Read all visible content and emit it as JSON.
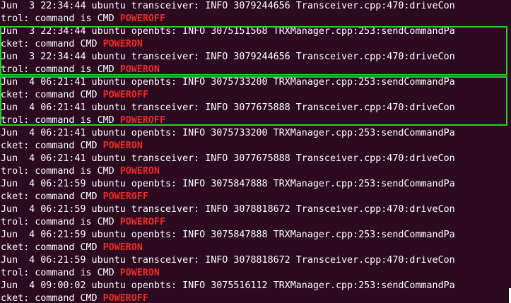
{
  "terminal": {
    "lines": [
      {
        "text": "Jun  3 22:34:44 ubuntu transceiver: INFO 3079244656 Transceiver.cpp:470:driveCon",
        "keyword": ""
      },
      {
        "text": "trol: command is CMD ",
        "keyword": "POWEROFF"
      },
      {
        "text": "Jun  3 22:34:44 ubuntu openbts: INFO 3075151568 TRXManager.cpp:253:sendCommandPa",
        "keyword": ""
      },
      {
        "text": "cket: command CMD ",
        "keyword": "POWERON"
      },
      {
        "text": "Jun  3 22:34:44 ubuntu transceiver: INFO 3079244656 Transceiver.cpp:470:driveCon",
        "keyword": ""
      },
      {
        "text": "trol: command is CMD ",
        "keyword": "POWERON"
      },
      {
        "text": "Jun  4 06:21:41 ubuntu openbts: INFO 3075733200 TRXManager.cpp:253:sendCommandPa",
        "keyword": ""
      },
      {
        "text": "cket: command CMD ",
        "keyword": "POWEROFF"
      },
      {
        "text": "Jun  4 06:21:41 ubuntu transceiver: INFO 3077675888 Transceiver.cpp:470:driveCon",
        "keyword": ""
      },
      {
        "text": "trol: command is CMD ",
        "keyword": "POWEROFF"
      },
      {
        "text": "Jun  4 06:21:41 ubuntu openbts: INFO 3075733200 TRXManager.cpp:253:sendCommandPa",
        "keyword": ""
      },
      {
        "text": "cket: command CMD ",
        "keyword": "POWERON"
      },
      {
        "text": "Jun  4 06:21:41 ubuntu transceiver: INFO 3077675888 Transceiver.cpp:470:driveCon",
        "keyword": ""
      },
      {
        "text": "trol: command is CMD ",
        "keyword": "POWERON"
      },
      {
        "text": "Jun  4 06:21:59 ubuntu openbts: INFO 3075847888 TRXManager.cpp:253:sendCommandPa",
        "keyword": ""
      },
      {
        "text": "cket: command CMD ",
        "keyword": "POWEROFF"
      },
      {
        "text": "Jun  4 06:21:59 ubuntu transceiver: INFO 3078818672 Transceiver.cpp:470:driveCon",
        "keyword": ""
      },
      {
        "text": "trol: command is CMD ",
        "keyword": "POWEROFF"
      },
      {
        "text": "Jun  4 06:21:59 ubuntu openbts: INFO 3075847888 TRXManager.cpp:253:sendCommandPa",
        "keyword": ""
      },
      {
        "text": "cket: command CMD ",
        "keyword": "POWERON"
      },
      {
        "text": "Jun  4 06:21:59 ubuntu transceiver: INFO 3078818672 Transceiver.cpp:470:driveCon",
        "keyword": ""
      },
      {
        "text": "trol: command is CMD ",
        "keyword": "POWERON"
      },
      {
        "text": "Jun  4 09:00:02 ubuntu openbts: INFO 3075516112 TRXManager.cpp:253:sendCommandPa",
        "keyword": ""
      },
      {
        "text": "cket: command CMD ",
        "keyword": "POWEROFF"
      }
    ]
  },
  "colors": {
    "background": "#2c0a1f",
    "text": "#ffffff",
    "keyword": "#ef2929",
    "highlight_box": "#22d12a"
  }
}
